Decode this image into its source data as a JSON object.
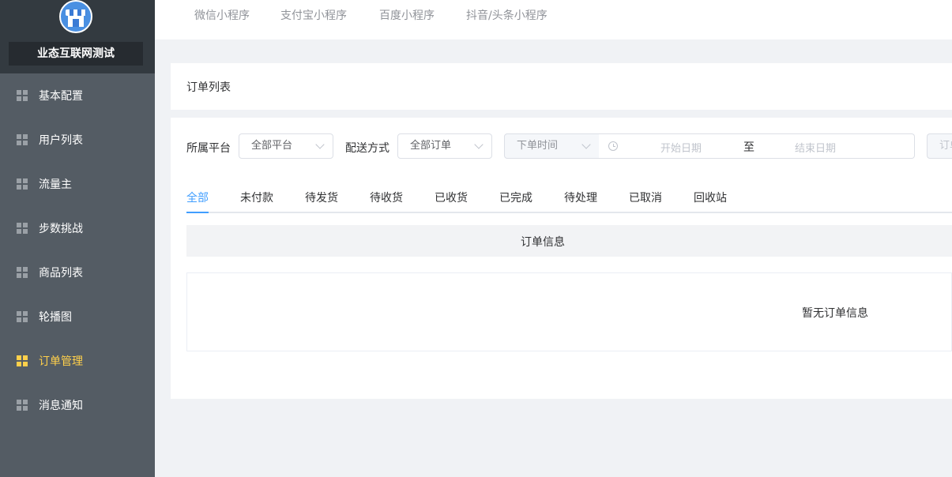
{
  "sidebar": {
    "brand_name": "业态互联网测试",
    "items": [
      {
        "label": "基本配置",
        "name": "sidebar-item-basic-config",
        "active": false
      },
      {
        "label": "用户列表",
        "name": "sidebar-item-user-list",
        "active": false
      },
      {
        "label": "流量主",
        "name": "sidebar-item-traffic-owner",
        "active": false
      },
      {
        "label": "步数挑战",
        "name": "sidebar-item-step-challenge",
        "active": false
      },
      {
        "label": "商品列表",
        "name": "sidebar-item-product-list",
        "active": false
      },
      {
        "label": "轮播图",
        "name": "sidebar-item-carousel",
        "active": false
      },
      {
        "label": "订单管理",
        "name": "sidebar-item-order-management",
        "active": true
      },
      {
        "label": "消息通知",
        "name": "sidebar-item-notifications",
        "active": false
      }
    ]
  },
  "top_tabs": [
    "微信小程序",
    "支付宝小程序",
    "百度小程序",
    "抖音/头条小程序"
  ],
  "page_title": "订单列表",
  "filters": {
    "platform_label": "所属平台",
    "platform_value": "全部平台",
    "delivery_label": "配送方式",
    "delivery_value": "全部订单",
    "time_value": "下单时间",
    "start_placeholder": "开始日期",
    "range_separator": "至",
    "end_placeholder": "结束日期",
    "cut_input_text": "订单"
  },
  "status_tabs": [
    "全部",
    "未付款",
    "待发货",
    "待收货",
    "已收货",
    "已完成",
    "待处理",
    "已取消",
    "回收站"
  ],
  "active_status_tab": 0,
  "table": {
    "header": "订单信息",
    "empty_text": "暂无订单信息"
  },
  "colors": {
    "sidebar_bg": "#545c64",
    "active_menu": "#ffd04b",
    "accent": "#409eff"
  }
}
